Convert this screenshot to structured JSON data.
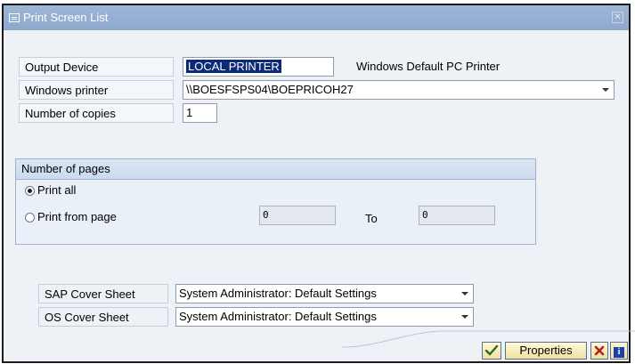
{
  "dialog": {
    "title": "Print Screen List",
    "close_icon": "close-icon"
  },
  "form": {
    "output_device_label": "Output Device",
    "output_device_value": "LOCAL PRINTER",
    "output_device_desc": "Windows Default PC Printer",
    "windows_printer_label": "Windows printer",
    "windows_printer_value": "\\\\BOESFSPS04\\BOEPRICOH27",
    "copies_label": "Number of copies",
    "copies_value": "1"
  },
  "pages_group": {
    "title": "Number of pages",
    "print_all_label": "Print all",
    "print_all_selected": true,
    "print_from_label": "Print from page",
    "from_value": "0",
    "to_label": "To",
    "to_value": "0"
  },
  "cover": {
    "sap_label": "SAP Cover Sheet",
    "sap_value": "System Administrator: Default Settings",
    "os_label": "OS Cover Sheet",
    "os_value": "System Administrator: Default Settings"
  },
  "footer": {
    "ok_icon": "checkmark-icon",
    "properties_label": "Properties",
    "cancel_icon": "cancel-x-icon",
    "info_icon": "info-icon"
  }
}
